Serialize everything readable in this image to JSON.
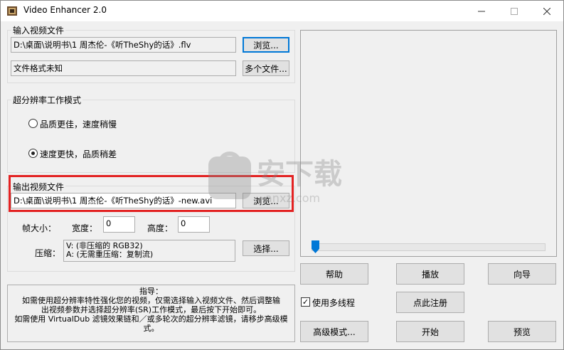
{
  "window": {
    "title": "Video Enhancer 2.0",
    "minimize_icon": "minimize-icon",
    "maximize_icon": "maximize-icon",
    "close_icon": "close-icon"
  },
  "input": {
    "group_label": "输入视频文件",
    "path": "D:\\桌面\\说明书\\1 周杰伦-《听TheShy的话》.flv",
    "browse_label": "浏览...",
    "format_text": "文件格式未知",
    "multi_label": "多个文件..."
  },
  "mode": {
    "group_label": "超分辨率工作模式",
    "option1": "品质更佳，速度稍慢",
    "option2": "速度更快，品质稍差",
    "selected": "option2"
  },
  "output": {
    "group_label": "输出视频文件",
    "path": "D:\\桌面\\说明书\\1 周杰伦-《听TheShy的话》-new.avi",
    "browse_label": "浏览...",
    "frame_size_label": "帧大小：",
    "width_label": "宽度：",
    "width_value": "0",
    "height_label": "高度：",
    "height_value": "0",
    "compress_label": "压缩：",
    "compress_line1": "V: (非压缩的 RGB32)",
    "compress_line2": "A: (无需重压缩：复制流)",
    "select_label": "选择..."
  },
  "hint": {
    "title": "指导：",
    "line1": "如需使用超分辨率特性强化您的视频，仅需选择输入视频文件、然后调整输",
    "line2": "出视频参数并选择超分辨率(SR)工作模式，最后按下开始即可。",
    "line3": "如需使用 VirtualDub 滤镜效果链和／或多轮次的超分辨率滤镜，请移步高级模",
    "line4": "式。"
  },
  "buttons": {
    "help": "帮助",
    "play": "播放",
    "wizard": "向导",
    "register": "点此注册",
    "advanced": "高级模式...",
    "start": "开始",
    "preview": "预览"
  },
  "multithread": {
    "label": "使用多线程",
    "checked": true,
    "check_glyph": "✓"
  },
  "slider": {
    "position_fraction": 0.0
  },
  "watermark": {
    "text_main": "安下载",
    "text_sub": "anxz.com"
  }
}
